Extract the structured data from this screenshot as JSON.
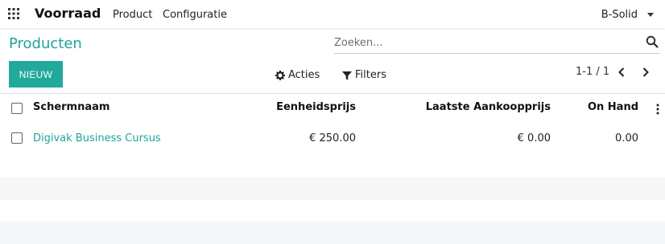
{
  "navbar": {
    "app_name": "Voorraad",
    "menu": [
      "Product",
      "Configuratie"
    ],
    "company": "B-Solid"
  },
  "control_panel": {
    "title": "Producten",
    "search_placeholder": "Zoeken...",
    "new_button": "NIEUW",
    "actions_label": "Acties",
    "filters_label": "Filters",
    "pager": "1-1 / 1"
  },
  "table": {
    "columns": [
      "Schermnaam",
      "Eenheidsprijs",
      "Laatste Aankoopprijs",
      "On Hand"
    ],
    "rows": [
      {
        "name": "Digivak Business Cursus",
        "unit_price": "€ 250.00",
        "last_purchase_price": "€ 0.00",
        "on_hand": "0.00"
      }
    ]
  },
  "colors": {
    "brand": "#21a99c",
    "link": "#1fa39a"
  },
  "icons": [
    "apps-icon",
    "search-icon",
    "gear-icon",
    "filter-icon",
    "chevron-left-icon",
    "chevron-right-icon",
    "caret-down-icon",
    "kebab-icon"
  ]
}
